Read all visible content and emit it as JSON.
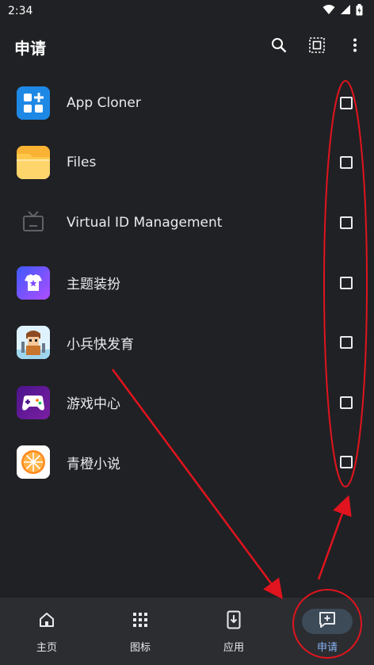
{
  "status_bar": {
    "time": "2:34",
    "icons": [
      "wifi-icon",
      "signal-icon",
      "battery-icon"
    ]
  },
  "app_bar": {
    "title": "申请",
    "actions": [
      "search-icon",
      "select-all-icon",
      "more-vert-icon"
    ]
  },
  "apps": [
    {
      "name": "App Cloner",
      "icon": "app-cloner-icon",
      "color": "#1e88e5",
      "checked": false
    },
    {
      "name": "Files",
      "icon": "folder-icon",
      "color": "#f9b233",
      "checked": false
    },
    {
      "name": "Virtual ID Management",
      "icon": "tv-icon",
      "color": "#202124",
      "checked": false
    },
    {
      "name": "主题装扮",
      "icon": "theme-shirt-icon",
      "color": "#7c4dff",
      "checked": false
    },
    {
      "name": "小兵快发育",
      "icon": "game-character-icon",
      "color": "#4fc3f7",
      "checked": false
    },
    {
      "name": "游戏中心",
      "icon": "gamepad-icon",
      "color": "#6a1b9a",
      "checked": false
    },
    {
      "name": "青橙小说",
      "icon": "orange-slice-icon",
      "color": "#ffffff",
      "checked": false
    }
  ],
  "bottom_nav": [
    {
      "label": "主页",
      "icon": "home-icon",
      "active": false
    },
    {
      "label": "图标",
      "icon": "grid-icon",
      "active": false
    },
    {
      "label": "应用",
      "icon": "app-install-icon",
      "active": false
    },
    {
      "label": "申请",
      "icon": "request-icon",
      "active": true
    }
  ],
  "colors": {
    "background": "#202124",
    "nav_background": "#2b2d31",
    "accent": "#8ab4f8",
    "annotation": "#e0141e"
  }
}
